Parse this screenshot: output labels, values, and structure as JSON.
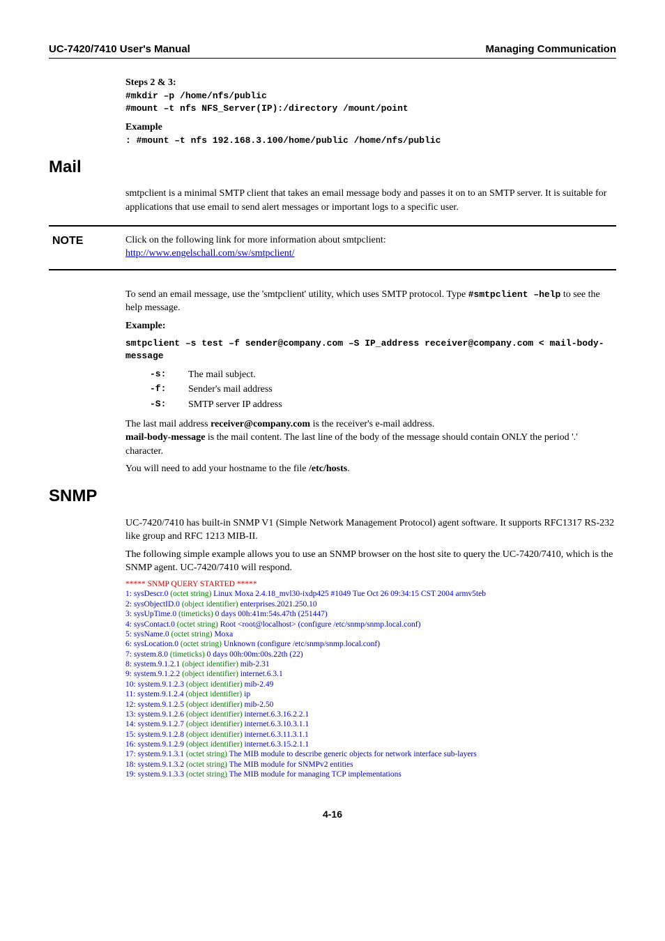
{
  "header": {
    "left": "UC-7420/7410 User's Manual",
    "right": "Managing Communication"
  },
  "steps": {
    "title": "Steps 2 & 3:",
    "line1": "#mkdir –p  /home/nfs/public",
    "line2": "#mount  –t  nfs  NFS_Server(IP):/directory  /mount/point",
    "example_label": "Example",
    "example_cmd": ": #mount –t nfs 192.168.3.100/home/public  /home/nfs/public"
  },
  "mail": {
    "heading": "Mail",
    "para1": "smtpclient is a minimal SMTP client that takes an email message body and passes it on to an SMTP server. It is suitable for applications that use email to send alert messages or important logs to a specific user.",
    "note_label": "NOTE",
    "note_text": "Click on the following link for more information about smtpclient:",
    "note_link": "http://www.engelschall.com/sw/smtpclient/",
    "para2a": "To send an email message, use the 'smtpclient' utility, which uses SMTP protocol. Type ",
    "para2b": "#smtpclient –help",
    "para2c": " to see the help message.",
    "example_label": "Example:",
    "cmd": "smtpclient  –s  test  –f  sender@company.com  –S  IP_address  receiver@company.com  <  mail-body-message",
    "flags": [
      {
        "key": "-s:",
        "desc": "The mail subject."
      },
      {
        "key": "-f:",
        "desc": "Sender's mail address"
      },
      {
        "key": "-S:",
        "desc": "SMTP server IP address"
      }
    ],
    "last1a": "The last mail address ",
    "last1b": "receiver@company.com",
    "last1c": " is the receiver's e-mail address.",
    "last2a": "mail-body-message",
    "last2b": " is the mail content. The last line of the body of the message should contain ONLY the period '.' character.",
    "last3a": "You will need to add your hostname to the file ",
    "last3b": "/etc/hosts",
    "last3c": "."
  },
  "snmp": {
    "heading": "SNMP",
    "para1": "UC-7420/7410 has built-in SNMP V1 (Simple Network Management Protocol) agent software. It supports RFC1317 RS-232 like group and RFC 1213 MIB-II.",
    "para2": "The following simple example allows you to use an SNMP browser on the host site to query the UC-7420/7410, which is the SNMP agent. UC-7420/7410 will respond.",
    "lines": [
      {
        "full_red": "***** SNMP QUERY STARTED *****"
      },
      {
        "prefix": "1: sysDescr.0 ",
        "type": "(octet string)",
        "value": " Linux Moxa 2.4.18_mvl30-ixdp425 #1049 Tue Oct 26 09:34:15 CST 2004 armv5teb"
      },
      {
        "prefix": "2: sysObjectID.0 ",
        "type": "(object identifier)",
        "value": " enterprises.2021.250.10"
      },
      {
        "prefix": "3: sysUpTime.0 ",
        "type": "(timeticks)",
        "value": " 0 days 00h:41m:54s.47th (251447)"
      },
      {
        "prefix": "4: sysContact.0 ",
        "type": "(octet string)",
        "value": " Root <root@localhost> (configure /etc/snmp/snmp.local.conf)"
      },
      {
        "prefix": "5: sysName.0 ",
        "type": "(octet string)",
        "value": " Moxa"
      },
      {
        "prefix": "6: sysLocation.0 ",
        "type": "(octet string)",
        "value": " Unknown (configure /etc/snmp/snmp.local.conf)"
      },
      {
        "prefix": "7: system.8.0 ",
        "type": "(timeticks)",
        "value": " 0 days 00h:00m:00s.22th (22)"
      },
      {
        "prefix": "8: system.9.1.2.1 ",
        "type": "(object identifier)",
        "value": " mib-2.31"
      },
      {
        "prefix": "9: system.9.1.2.2 ",
        "type": "(object identifier)",
        "value": " internet.6.3.1"
      },
      {
        "prefix": "10: system.9.1.2.3 ",
        "type": "(object identifier)",
        "value": " mib-2.49"
      },
      {
        "prefix": "11: system.9.1.2.4 ",
        "type": "(object identifier)",
        "value": " ip"
      },
      {
        "prefix": "12: system.9.1.2.5 ",
        "type": "(object identifier)",
        "value": " mib-2.50"
      },
      {
        "prefix": "13: system.9.1.2.6 ",
        "type": "(object identifier)",
        "value": " internet.6.3.16.2.2.1"
      },
      {
        "prefix": "14: system.9.1.2.7 ",
        "type": "(object identifier)",
        "value": " internet.6.3.10.3.1.1"
      },
      {
        "prefix": "15: system.9.1.2.8 ",
        "type": "(object identifier)",
        "value": " internet.6.3.11.3.1.1"
      },
      {
        "prefix": "16: system.9.1.2.9 ",
        "type": "(object identifier)",
        "value": " internet.6.3.15.2.1.1"
      },
      {
        "prefix": "17: system.9.1.3.1 ",
        "type": "(octet string)",
        "value": " The MIB module to describe generic objects for network interface sub-layers"
      },
      {
        "prefix": "18: system.9.1.3.2 ",
        "type": "(octet string)",
        "value": " The MIB module for SNMPv2 entities"
      },
      {
        "prefix": "19: system.9.1.3.3 ",
        "type": "(octet string)",
        "value": " The MIB module for managing TCP implementations"
      }
    ]
  },
  "footer": "4-16"
}
